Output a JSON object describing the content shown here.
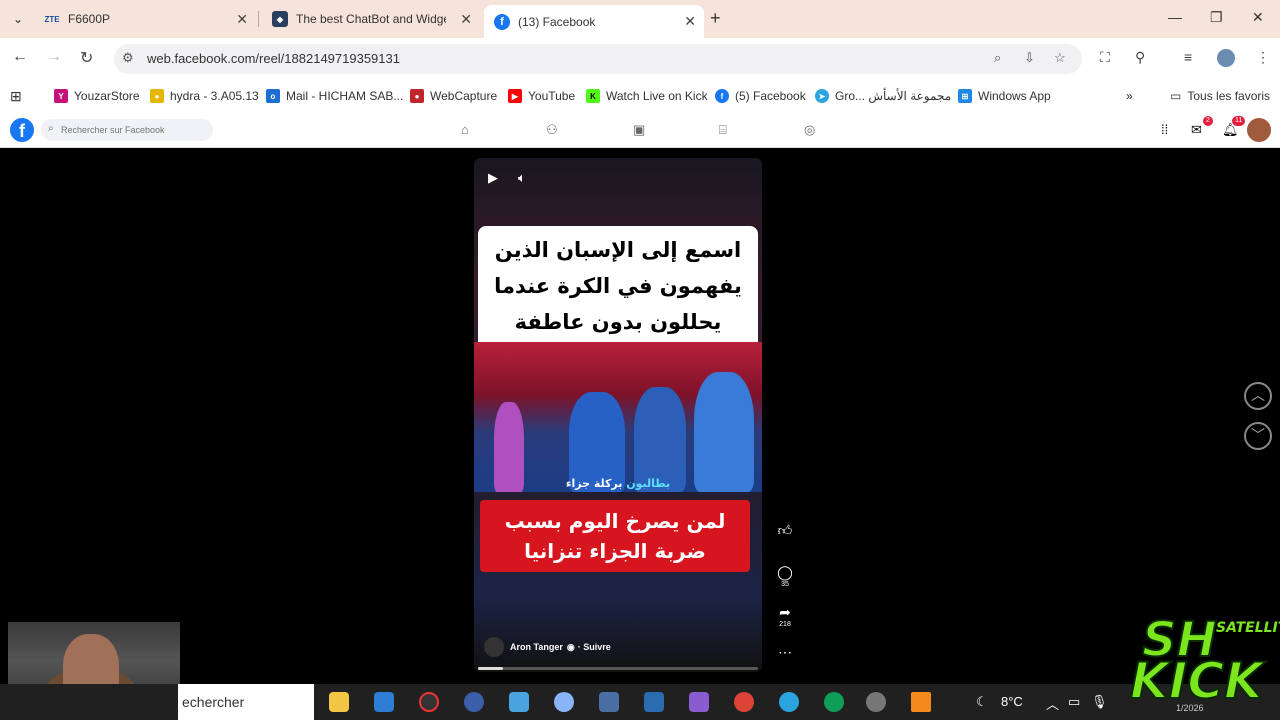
{
  "browser": {
    "tabs": [
      {
        "label": "F6600P",
        "favicon": "ZTE"
      },
      {
        "label": "The best ChatBot and Widgets",
        "favicon": "chatbot-icon"
      },
      {
        "label": "(13) Facebook",
        "favicon": "facebook-icon"
      }
    ],
    "url": "web.facebook.com/reel/1882149719359131",
    "bookmarks": [
      {
        "label": "YouzarStore"
      },
      {
        "label": "hydra - 3.A05.13"
      },
      {
        "label": "Mail - HICHAM SAB..."
      },
      {
        "label": "WebCapture"
      },
      {
        "label": "YouTube"
      },
      {
        "label": "Watch Live on Kick"
      },
      {
        "label": "(5) Facebook"
      },
      {
        "label": "Gro... مجموعة الأسأش"
      },
      {
        "label": "Windows App"
      }
    ],
    "all_bookmarks": "Tous les favoris"
  },
  "facebook": {
    "search_placeholder": "Rechercher sur Facebook",
    "messenger_badge": "2",
    "notification_badge": "11"
  },
  "reel": {
    "caption_top": "اسمع إلى الإسبان الذين يفهمون في الكرة عندما يحللون بدون عاطفة اوتحيز",
    "scene_subtitle_prefix": "بطالبون",
    "scene_subtitle_rest": " بركلة جزاء",
    "caption_red": "لمن يصرخ اليوم بسبب ضربة الجزاء تنزانيا",
    "author": "Aron Tanger",
    "follow": "· Suivre",
    "comments": "35",
    "shares": "218",
    "progress": 0.09
  },
  "taskbar": {
    "search_text": "echercher",
    "temperature": "8°C"
  },
  "overlay": {
    "logo_sh": "SH",
    "logo_satellite": "SATELLITE",
    "logo_kick": "KICK",
    "date": "1/2026"
  },
  "colors": {
    "facebook_blue": "#1877f2",
    "tabstrip": "#f6e3d9",
    "red_caption": "#d6151f",
    "logo_green": "#7be51d"
  }
}
